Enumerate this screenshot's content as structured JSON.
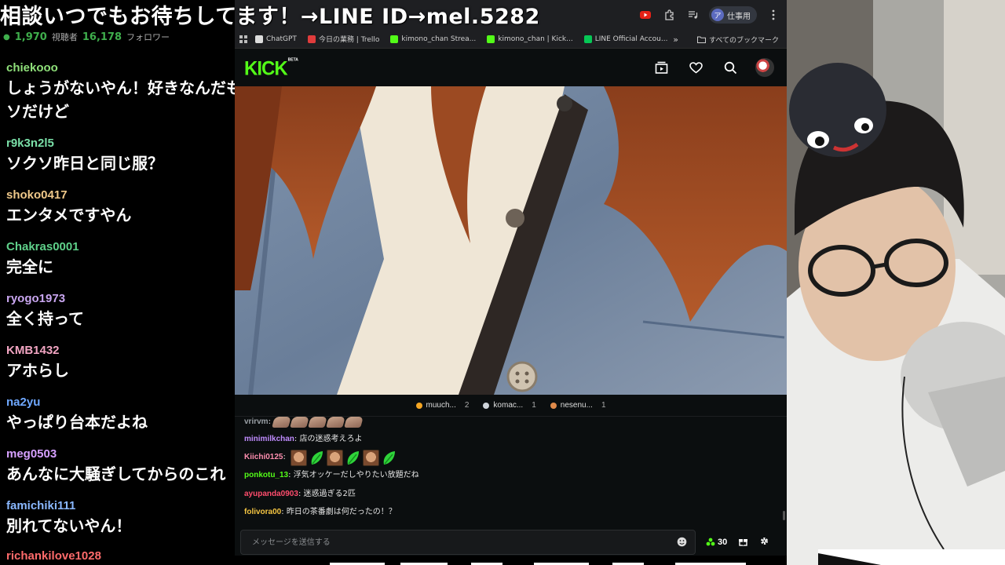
{
  "title_banner": "相談いつでもお待ちしてます！→LINE ID→mel.5282",
  "stats": {
    "viewers": "1,970",
    "viewers_label": "視聴者",
    "followers": "16,178",
    "followers_label": "フォロワー"
  },
  "left_chat": [
    {
      "user": "chiekooo",
      "text": "しょうがないやん！好きなんだもん\nソだけど",
      "color": "#8fe07a"
    },
    {
      "user": "r9k3n2l5",
      "text": "ソクソ昨日と同じ服？",
      "color": "#7ae0a8"
    },
    {
      "user": "shoko0417",
      "text": "エンタメですやん",
      "color": "#f0c98a"
    },
    {
      "user": "Chakras0001",
      "text": "完全に",
      "color": "#5fd18a"
    },
    {
      "user": "ryogo1973",
      "text": "全く持って",
      "color": "#c9a6f0"
    },
    {
      "user": "KMB1432",
      "text": "アホらし",
      "color": "#f2a5c2"
    },
    {
      "user": "na2yu",
      "text": "やっぱり台本だよね",
      "color": "#6fa8ff"
    },
    {
      "user": "meg0503",
      "text": "あんなに大騒ぎしてからのこれ",
      "color": "#d6a0ff"
    },
    {
      "user": "famichiki111",
      "text": "別れてないやん！",
      "color": "#8ab8ff"
    },
    {
      "user": "richankilove1028",
      "text": "",
      "color": "#ff6b6b"
    }
  ],
  "browser": {
    "profile_label": "仕事用",
    "profile_initial": "ア",
    "bookmarks": [
      {
        "label": "",
        "color": "#888"
      },
      {
        "label": "ChatGPT",
        "color": "#ddd"
      },
      {
        "label": "今日の業務 | Trello",
        "color": "#e03c3c"
      },
      {
        "label": "kimono_chan Strea...",
        "color": "#53fc18"
      },
      {
        "label": "kimono_chan | Kick...",
        "color": "#53fc18"
      },
      {
        "label": "LINE Official Accou...",
        "color": "#06c755"
      }
    ],
    "bookmarks_more": "»",
    "all_bookmarks": "すべてのブックマーク"
  },
  "kick": {
    "logo": "KICK",
    "logo_badge": "BETA"
  },
  "leaderboard": [
    {
      "name": "muuch...",
      "count": "2",
      "color": "#f5a623"
    },
    {
      "name": "komac...",
      "count": "1",
      "color": "#cfd4da"
    },
    {
      "name": "nesenu...",
      "count": "1",
      "color": "#e08a4a"
    }
  ],
  "kick_chat": [
    {
      "user": "vrirvm",
      "sep": ":",
      "text": "",
      "color": "#9aa0a6",
      "emotes": "hands"
    },
    {
      "user": "minimilkchan",
      "sep": ": ",
      "text": "店の迷惑考えろよ",
      "color": "#c08cff",
      "emotes": ""
    },
    {
      "user": "Kiichi0125",
      "sep": ": ",
      "text": "",
      "color": "#ff8fb0",
      "emotes": "faces"
    },
    {
      "user": "ponkotu_13",
      "sep": ": ",
      "text": "浮気オッケーだしやりたい放題だね",
      "color": "#53fc18",
      "emotes": ""
    },
    {
      "user": "ayupanda0903",
      "sep": ": ",
      "text": "迷惑過ぎる2匹",
      "color": "#ff4d6d",
      "emotes": ""
    },
    {
      "user": "folivora00",
      "sep": ": ",
      "text": "昨日の茶番劇は何だったの！？",
      "color": "#f5c542",
      "emotes": ""
    }
  ],
  "chat_input": {
    "placeholder": "メッセージを送信する"
  },
  "points": "30"
}
